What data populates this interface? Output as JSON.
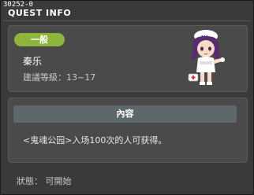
{
  "quest": {
    "id": "30252-0",
    "window_title": "QUEST INFO",
    "category": "一般",
    "name": "秦乐",
    "recommended_level": "建議等級：13~17"
  },
  "content": {
    "header": "內容",
    "description": "<鬼魂公园>入场100次的人可获得。"
  },
  "status": {
    "text": "狀態： 可開始"
  },
  "colors": {
    "category_badge": "#8fb43c",
    "panel_bg": "#4a4a4a",
    "content_header_bg": "#5e686a"
  },
  "icons": {
    "npc": "nurse-npc-portrait"
  }
}
